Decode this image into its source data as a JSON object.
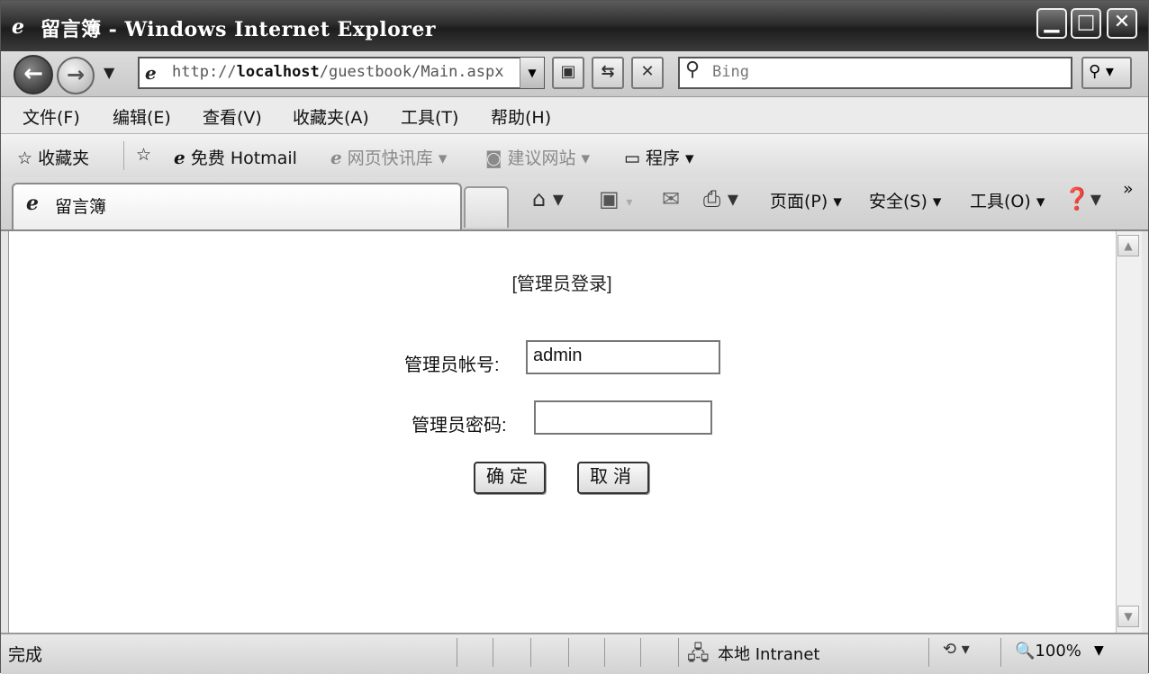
{
  "window": {
    "title": "留言簿 - Windows Internet Explorer",
    "minimize_glyph": "▁",
    "maximize_glyph": "□",
    "close_glyph": "✕"
  },
  "nav": {
    "url_prefix": "http://",
    "url_host": "localhost",
    "url_path": "/guestbook/Main.aspx",
    "search_placeholder": "Bing"
  },
  "menu": {
    "items": [
      "文件(F)",
      "编辑(E)",
      "查看(V)",
      "收藏夹(A)",
      "工具(T)",
      "帮助(H)"
    ]
  },
  "favorites": {
    "favorites_label": "收藏夹",
    "items": [
      "免费 Hotmail",
      "网页快讯库 ▾",
      "建议网站 ▾",
      "程序 ▾"
    ]
  },
  "tab": {
    "title": "留言簿"
  },
  "commandbar": {
    "page": "页面(P) ▾",
    "safety": "安全(S) ▾",
    "tools": "工具(O) ▾",
    "more": "»"
  },
  "page": {
    "heading": "[管理员登录]",
    "username_label": "管理员帐号:",
    "username_value": "admin",
    "password_label": "管理员密码:",
    "password_value": "",
    "ok_button": "确定",
    "cancel_button": "取消"
  },
  "status": {
    "text": "完成",
    "zone": "本地 Intranet",
    "zoom": "100%"
  },
  "icons": [
    "ie-logo-icon",
    "back-icon",
    "forward-icon",
    "compatibility-icon",
    "refresh-icon",
    "stop-icon",
    "search-icon",
    "favorites-star-icon",
    "add-favorites-icon",
    "home-icon",
    "feeds-icon",
    "mail-icon",
    "print-icon",
    "help-icon",
    "network-icon",
    "protected-mode-icon",
    "zoom-icon"
  ]
}
